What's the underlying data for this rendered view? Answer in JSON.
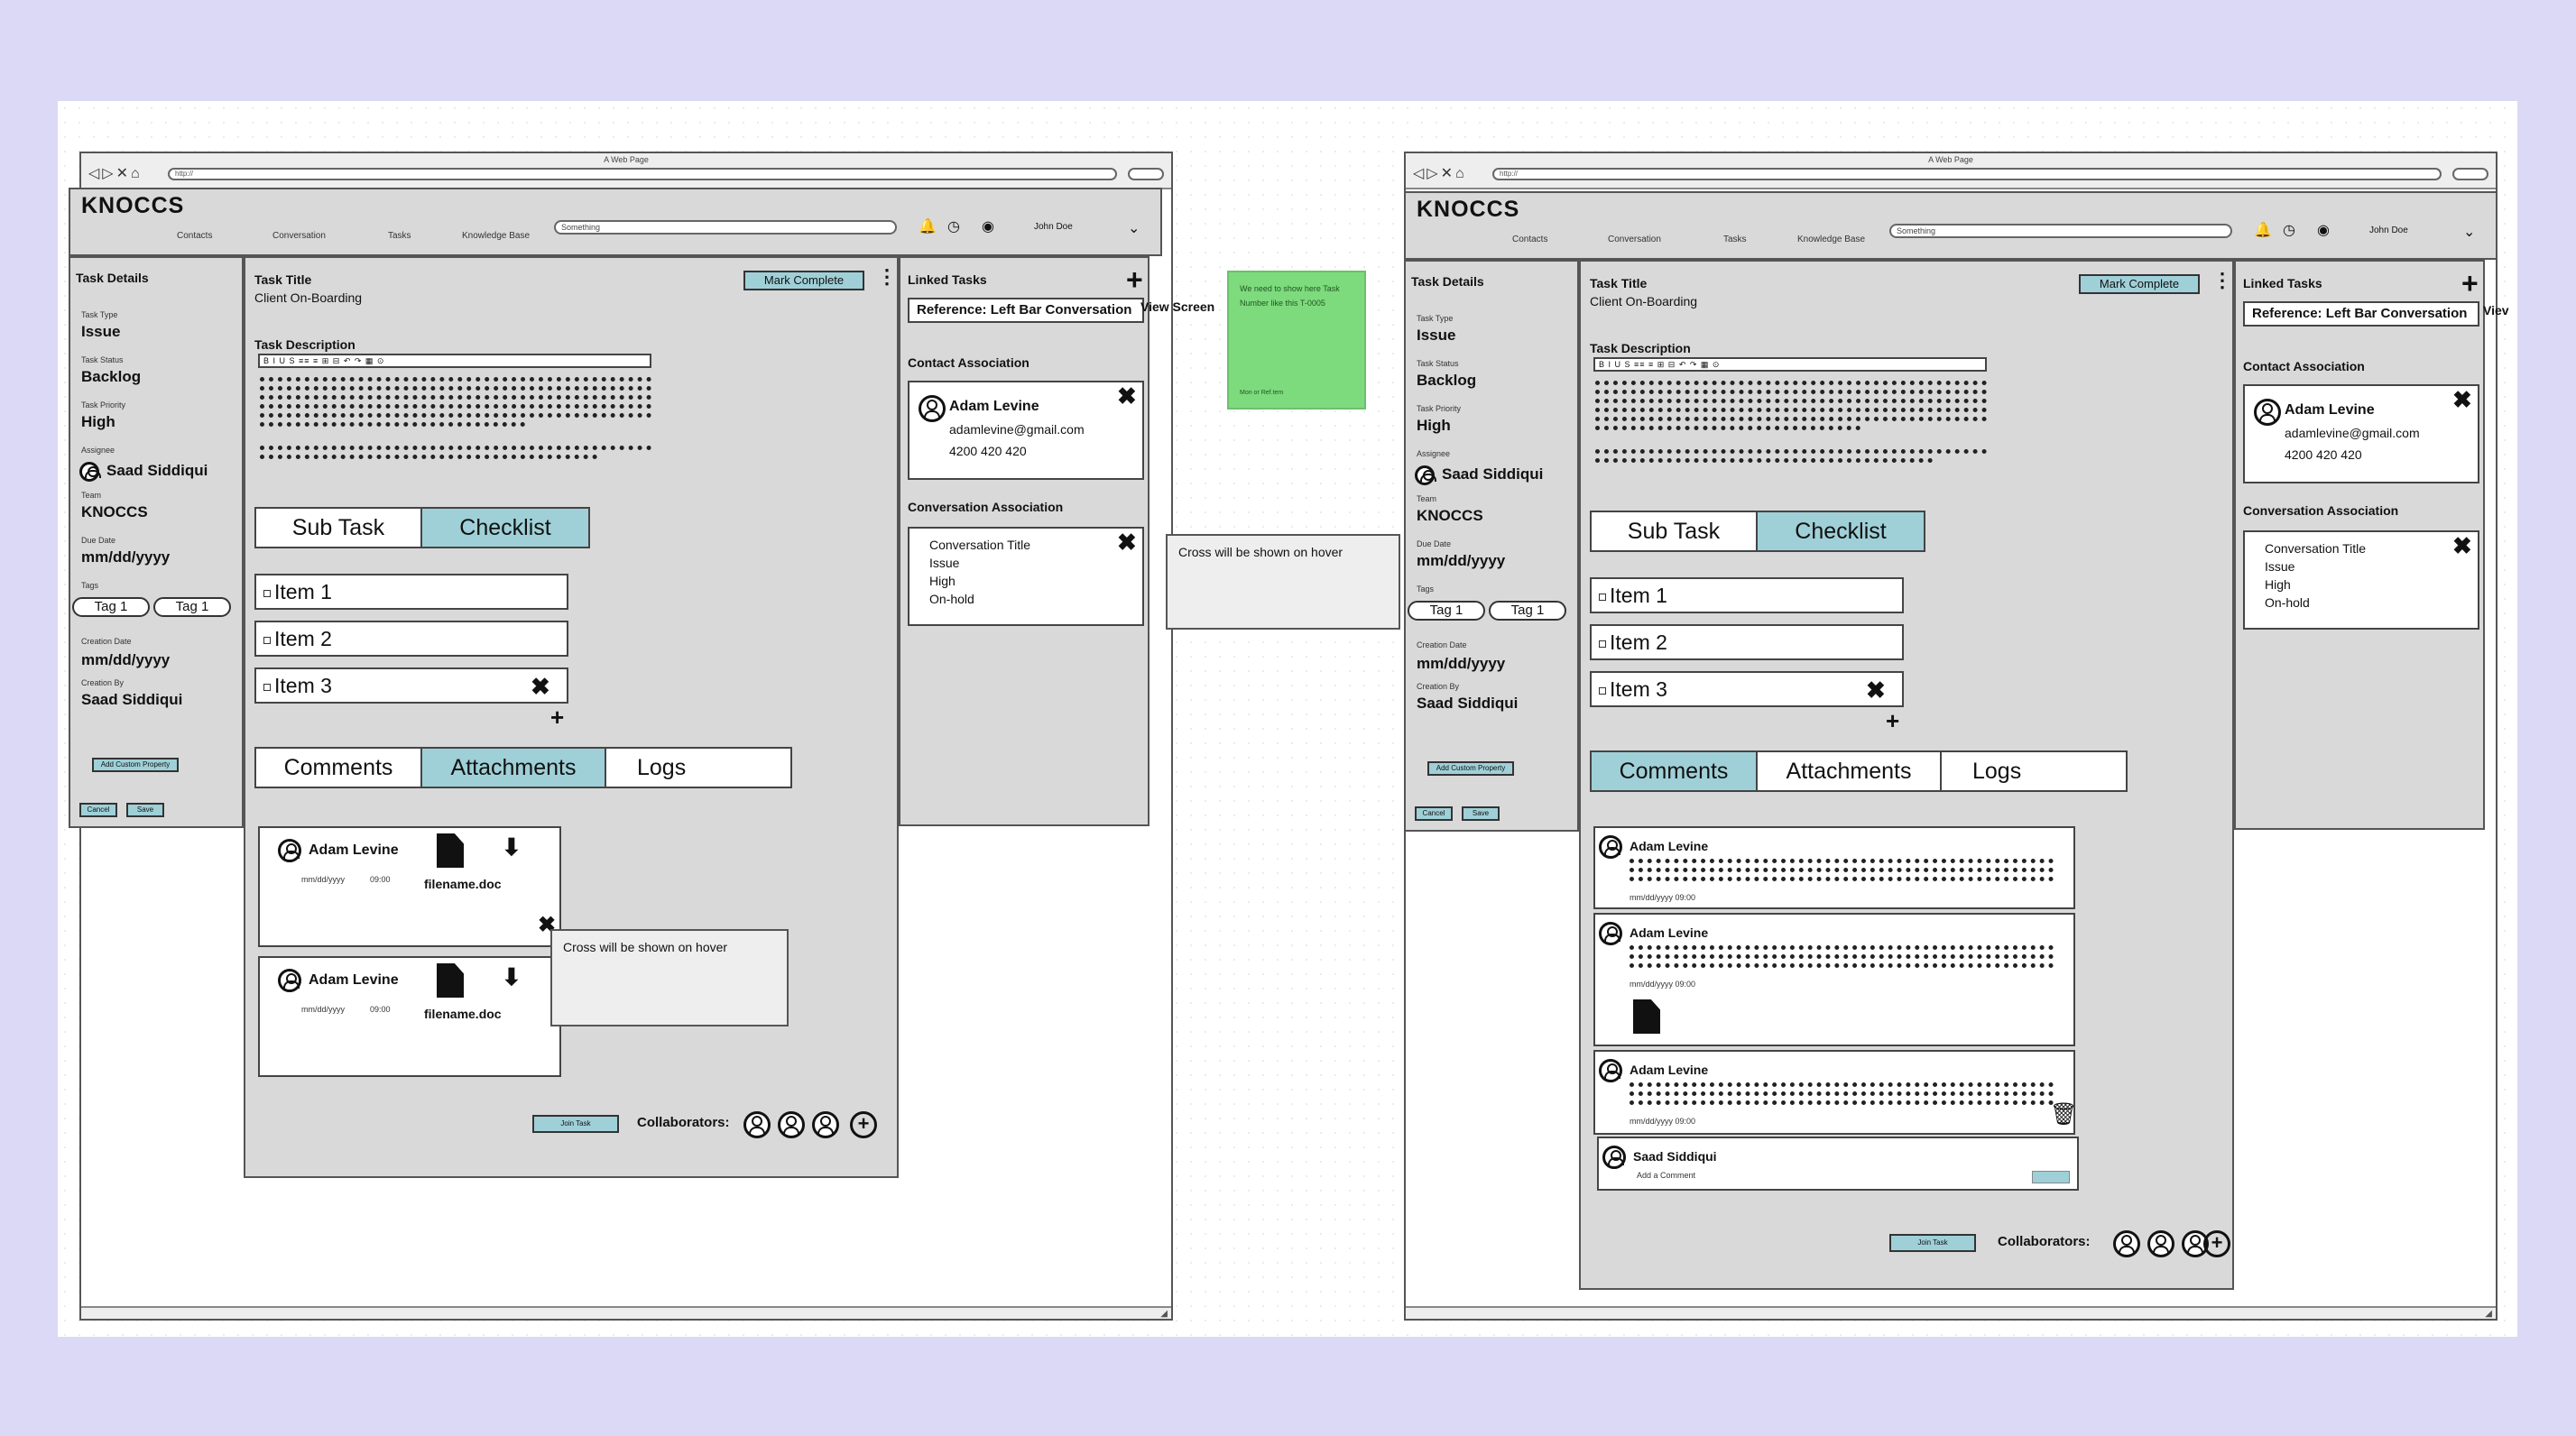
{
  "browser": {
    "page_title": "A Web Page",
    "url": "http://"
  },
  "app": {
    "logo": "KNOCCS",
    "nav": [
      "Contacts",
      "Conversation",
      "Tasks",
      "Knowledge Base"
    ],
    "search_placeholder": "Something",
    "user": "John Doe"
  },
  "details": {
    "heading": "Task Details",
    "task_type_label": "Task Type",
    "task_type": "Issue",
    "task_status_label": "Task Status",
    "task_status": "Backlog",
    "task_priority_label": "Task Priority",
    "task_priority": "High",
    "assignee_label": "Assignee",
    "assignee": "Saad Siddiqui",
    "team_label": "Team",
    "team": "KNOCCS",
    "due_date_label": "Due Date",
    "due_date": "mm/dd/yyyy",
    "tags_label": "Tags",
    "tags": [
      "Tag 1",
      "Tag 1"
    ],
    "creation_date_label": "Creation Date",
    "creation_date": "mm/dd/yyyy",
    "creation_by_label": "Creation By",
    "creation_by": "Saad Siddiqui",
    "add_custom_property": "Add Custom Property",
    "cancel": "Cancel",
    "save": "Save"
  },
  "main": {
    "title_label": "Task Title",
    "title_value": "Client On-Boarding",
    "mark_complete": "Mark Complete",
    "desc_label": "Task Description",
    "toolbar": "B I U S ≡≡ ≡ ⊞ ⊟ ↶ ↷ ▦ ⊙",
    "subtabs": [
      "Sub Task",
      "Checklist"
    ],
    "checklist": [
      "Item 1",
      "Item 2",
      "Item 3"
    ],
    "tabs": [
      "Comments",
      "Attachments",
      "Logs"
    ],
    "join_task": "Join Task",
    "collaborators": "Collaborators:"
  },
  "attachments": [
    {
      "name": "Adam Levine",
      "date": "mm/dd/yyyy",
      "time": "09:00",
      "file": "filename.doc"
    },
    {
      "name": "Adam Levine",
      "date": "mm/dd/yyyy",
      "time": "09:00",
      "file": "filename.doc"
    }
  ],
  "comments": [
    {
      "name": "Adam Levine",
      "meta": "mm/dd/yyyy 09:00"
    },
    {
      "name": "Adam Levine",
      "meta": "mm/dd/yyyy 09:00"
    },
    {
      "name": "Adam Levine",
      "meta": "mm/dd/yyyy 09:00"
    }
  ],
  "new_comment": {
    "name": "Saad Siddiqui",
    "placeholder": "Add a Comment"
  },
  "right": {
    "linked_tasks": "Linked Tasks",
    "reference": "Reference: Left Bar Conversation",
    "contact_assoc": "Contact Association",
    "contact": {
      "name": "Adam Levine",
      "email": "adamlevine@gmail.com",
      "phone": "4200 420 420"
    },
    "conv_assoc": "Conversation Association",
    "conversation": {
      "title": "Conversation Title",
      "type": "Issue",
      "priority": "High",
      "status": "On-hold"
    }
  },
  "notes": {
    "view_screen": "View Screen",
    "view_screen_short": "Viev",
    "sticky": "We need to show here Task Number like this T-0005",
    "sticky_footer": "Mon or Ref.tem",
    "hover_tip": "Cross will be shown on hover"
  }
}
